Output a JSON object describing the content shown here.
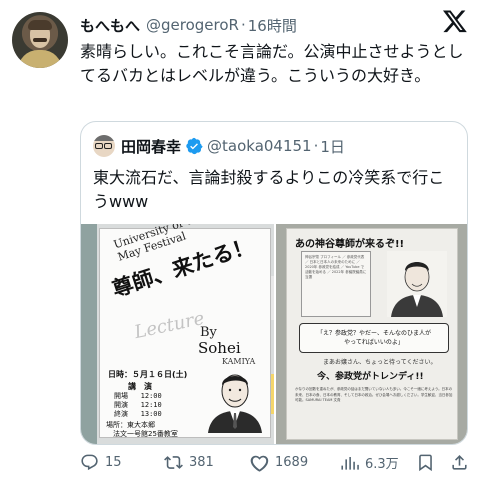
{
  "tweet": {
    "author_name": "もへもへ",
    "author_handle": "@gerogeroR",
    "separator": "·",
    "time": "16時間",
    "text": "素晴らしい。これこそ言論だ。公演中止させようとしてるバカとはレベルが違う。こういうの大好き。"
  },
  "quoted": {
    "author_name": "田岡春幸",
    "author_handle": "@taoka04151",
    "separator": "·",
    "time": "1日",
    "text": "東大流石だ、言論封殺するよりこの冷笑系で行こうwww",
    "poster_left": {
      "university": "University of Tokyo May Festival",
      "headline": "尊師、来たる！",
      "lecture": "Lecture",
      "by": "By",
      "sohei": "Sohei",
      "kamiya": "KAMIYA",
      "date": "日時：５月１６日(土)",
      "lecture_label": "講　演",
      "times": "開場   12:00\n開演   12:10\n終演   13:00",
      "venue": "場所：東大本郷\n　法文一号館25番教室"
    },
    "poster_right": {
      "headline": "あの神谷尊師が来るぞ!!",
      "profile": "神谷宗幣 プロフィール ／ 参政党代表 ／ 日本と日本人の未来のために ／ 2020年 参政党を結成 ／ YouTube で活動を始める ／ 2022年 参議院議員に当選",
      "callout": "「え？参政党？やだー、そんなのひま人が\nやってればいいのよ」",
      "mamo": "まあお嬢さん、ちょっと待ってください。",
      "trendy": "今、参政党がトレンディ!!",
      "fine": "かなりの回数を重ねたが、参政党の話はまだ聞いていない人も多い。今こそ一緒に考えよう。日本の未来、日本の食、日本の教育、そして日本の政治。ぜひ会場へお越しください。学生歓迎、当日参加可能。SAMURAI TEAM 文責"
    }
  },
  "actions": {
    "replies": "15",
    "reposts": "381",
    "likes": "1689",
    "views": "6.3万"
  },
  "colors": {
    "text": "#0f1419",
    "secondary": "#536471",
    "border": "#cfd9de",
    "verified": "#1d9bf0"
  }
}
